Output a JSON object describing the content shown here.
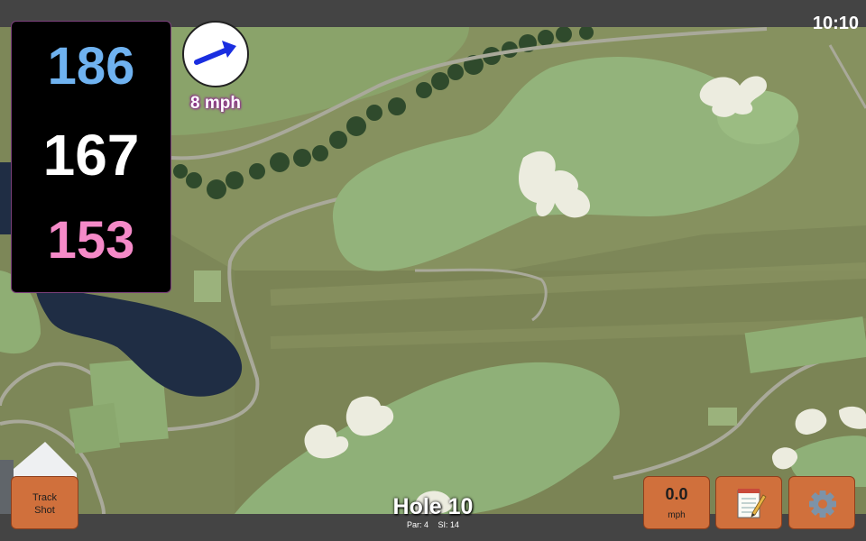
{
  "status_bar": {
    "time": "10:10"
  },
  "yardages": {
    "back": "186",
    "middle": "167",
    "front": "153"
  },
  "wind": {
    "speed": "8 mph",
    "direction": "blowing toward upper-right (east-northeast)",
    "arrow_color": "#1a2ee0"
  },
  "hole": {
    "title": "Hole 10",
    "par_label": "Par: 4",
    "si_label": "SI: 14"
  },
  "buttons": {
    "track_shot": "Track\nShot",
    "speed_value": "0.0",
    "speed_unit": "mph",
    "notes_icon": "notepad-icon",
    "settings_icon": "gear-icon"
  },
  "colors": {
    "panel_bg": "#000000",
    "back_yardage": "#6fb2f0",
    "middle_yardage": "#ffffff",
    "front_yardage": "#f58ac8",
    "button_orange": "#d0703c"
  }
}
